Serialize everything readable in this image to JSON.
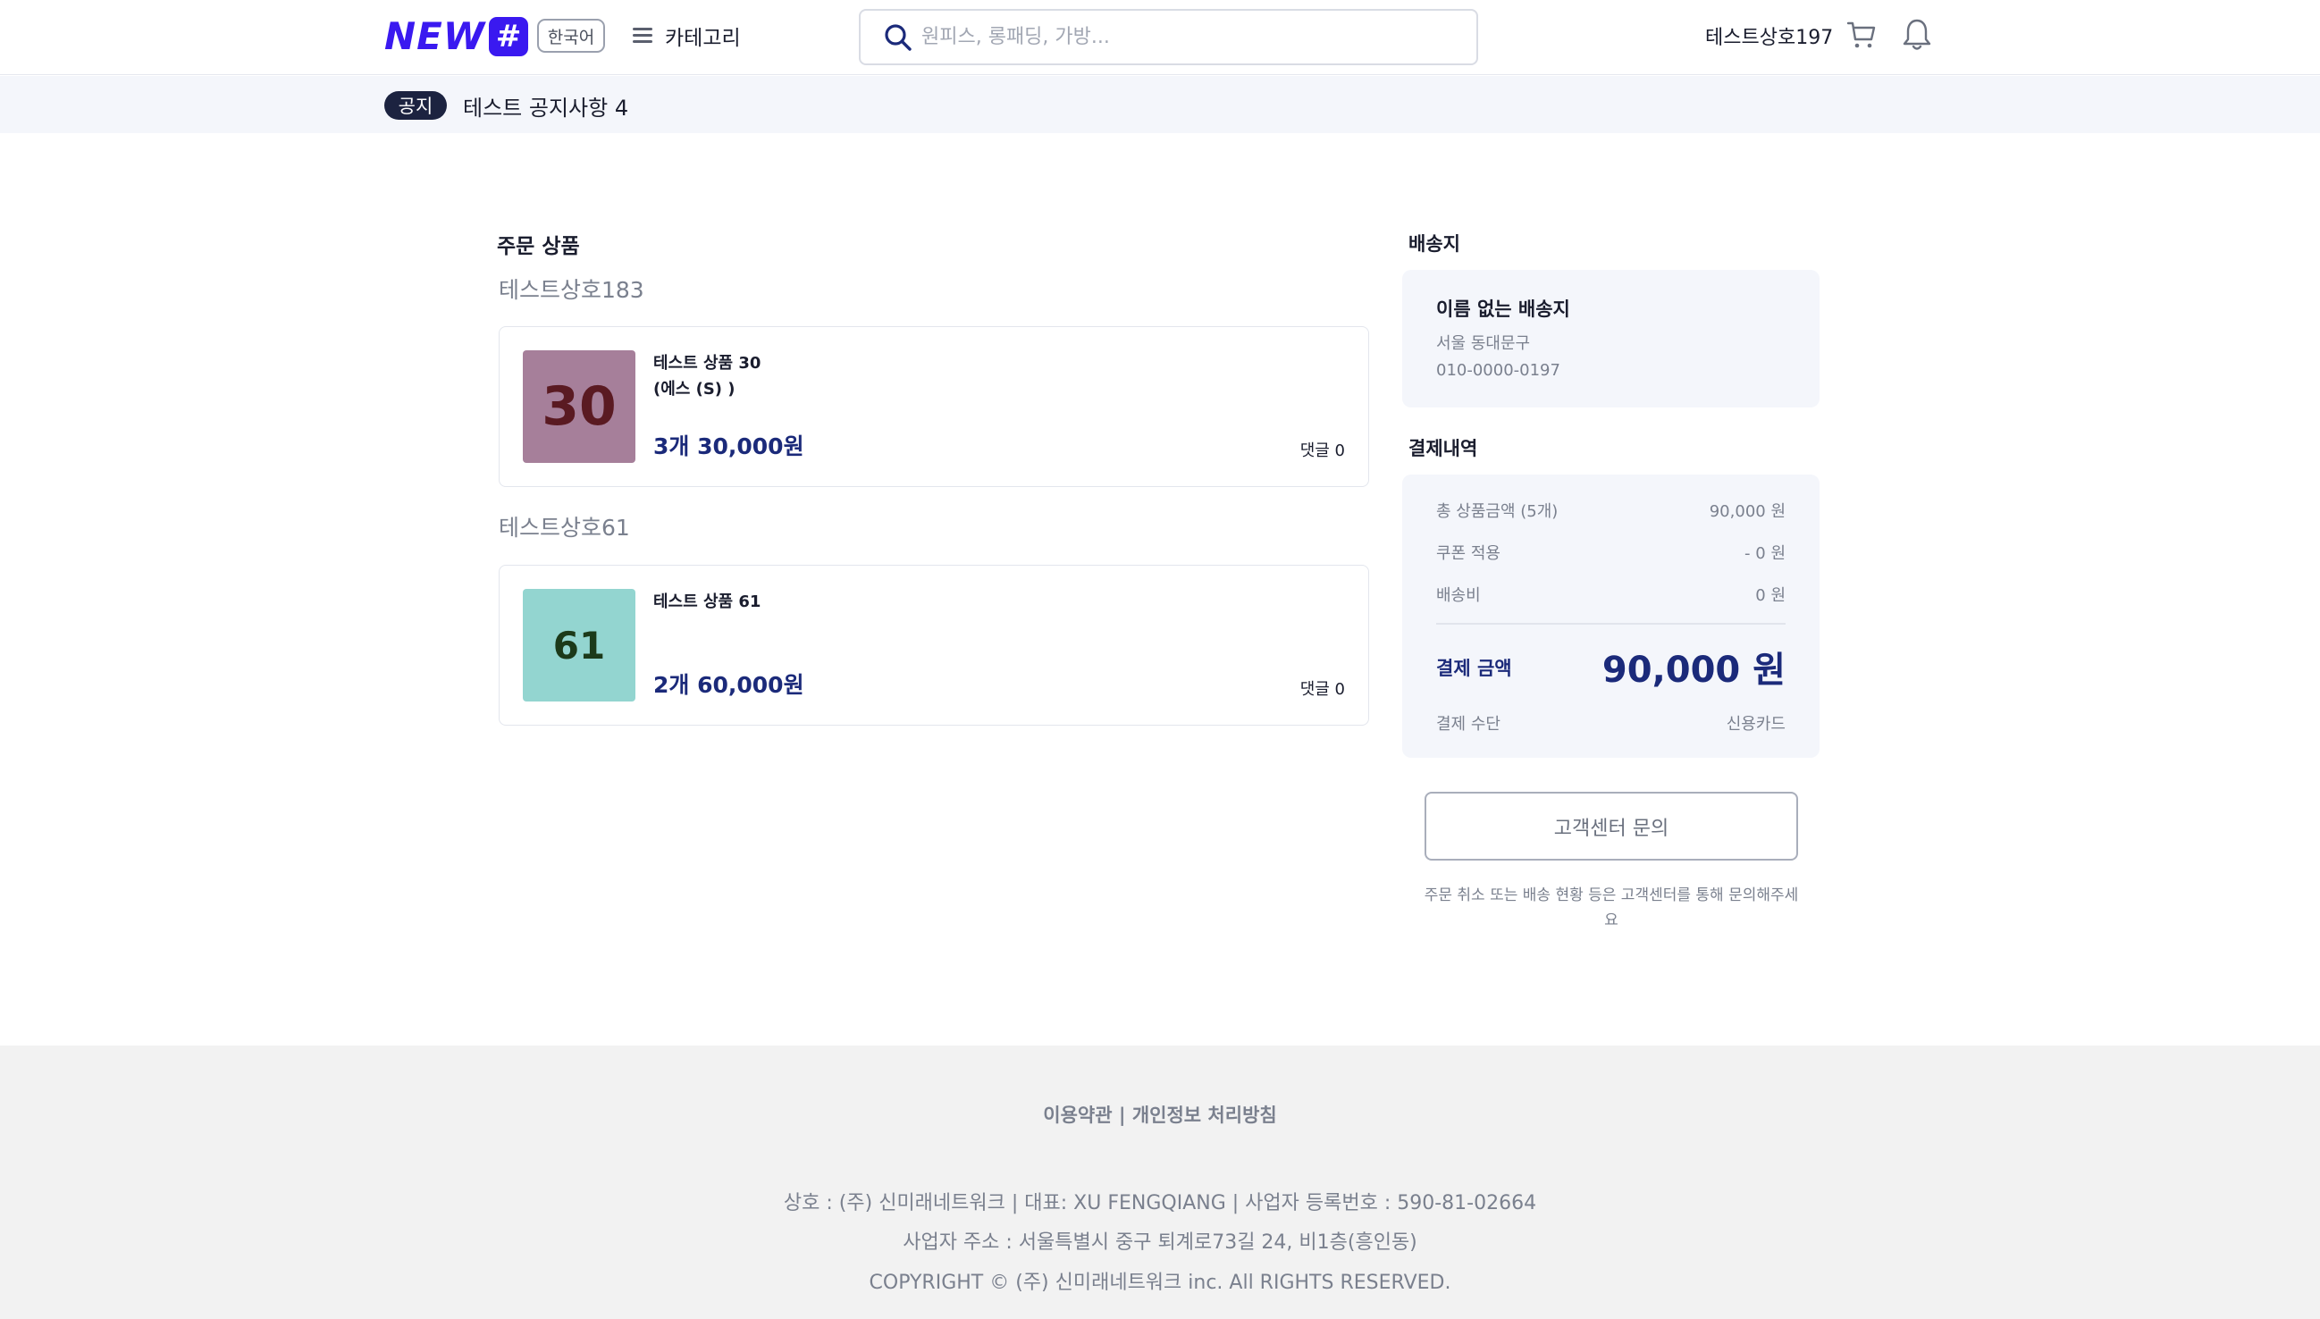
{
  "header": {
    "logo_text": "NEW",
    "logo_hash": "#",
    "language_label": "한국어",
    "category_label": "카테고리",
    "search_placeholder": "원피스, 롱패딩, 가방...",
    "user_name": "테스트상호197",
    "icons": [
      "search-icon",
      "cart-icon",
      "bell-icon",
      "hamburger-icon"
    ],
    "brand_color": "#3a19f0"
  },
  "notice": {
    "badge": "공지",
    "text": "테스트 공지사항 4"
  },
  "order": {
    "section_title": "주문 상품",
    "groups": [
      {
        "shop": "테스트상호183",
        "item": {
          "name": "테스트 상품 30",
          "option": "(에스 (S) )",
          "thumb_text": "30",
          "thumb_bg": "#a67f9a",
          "thumb_fg": "#5a1a22",
          "price": "3개 30,000원",
          "comments": "댓글 0"
        }
      },
      {
        "shop": "테스트상호61",
        "item": {
          "name": "테스트 상품 61",
          "option": "",
          "thumb_text": "61",
          "thumb_bg": "#93d5d0",
          "thumb_fg": "#1c3a1a",
          "price": "2개 60,000원",
          "comments": "댓글 0"
        }
      }
    ]
  },
  "shipping": {
    "section_title": "배송지",
    "name": "이름 없는 배송지",
    "address": "서울 동대문구",
    "phone": "010-0000-0197"
  },
  "payment": {
    "section_title": "결제내역",
    "rows": [
      {
        "label": "총 상품금액 (5개)",
        "value": "90,000 원"
      },
      {
        "label": "쿠폰 적용",
        "value": "- 0 원"
      },
      {
        "label": "배송비",
        "value": "0 원"
      }
    ],
    "total_label": "결제 금액",
    "total_value": "90,000 원",
    "method_label": "결제 수단",
    "method_value": "신용카드"
  },
  "support": {
    "button_label": "고객센터 문의",
    "note": "주문 취소 또는 배송 현황 등은 고객센터를 통해 문의해주세요"
  },
  "footer": {
    "links": "이용약관 | 개인정보 처리방침",
    "company": "상호 : (주) 신미래네트워크 | 대표: XU FENGQIANG | 사업자 등록번호 : 590-81-02664",
    "address": "사업자 주소 : 서울특별시 중구 퇴계로73길 24, 비1층(흥인동)",
    "copyright": "COPYRIGHT © (주) 신미래네트워크 inc. All RIGHTS RESERVED."
  }
}
